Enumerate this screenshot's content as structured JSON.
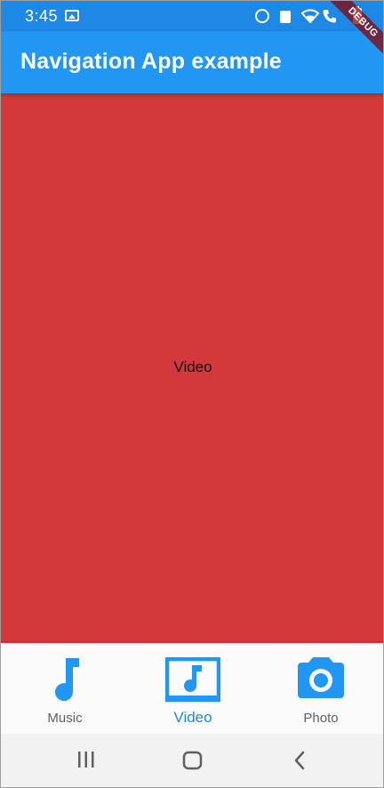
{
  "status_bar": {
    "time": "3:45",
    "icons": [
      "gallery-icon",
      "alarm-icon",
      "lock-icon",
      "wifi-icon",
      "call-icon",
      "battery-icon"
    ]
  },
  "debug_banner": "DEBUG",
  "app_bar": {
    "title": "Navigation App example"
  },
  "body": {
    "label": "Video",
    "background_color": "#d3383a"
  },
  "bottom_nav": {
    "selected_index": 1,
    "active_color": "#1e88e5",
    "inactive_color": "#616161",
    "items": [
      {
        "label": "Music",
        "icon": "music-note-icon"
      },
      {
        "label": "Video",
        "icon": "video-library-icon"
      },
      {
        "label": "Photo",
        "icon": "camera-icon"
      }
    ]
  },
  "system_nav": {
    "buttons": [
      "recents-icon",
      "home-icon",
      "back-icon"
    ]
  },
  "colors": {
    "status_bar": "#1e88e5",
    "app_bar": "#2196f3",
    "icon_blue": "#2196f3"
  }
}
